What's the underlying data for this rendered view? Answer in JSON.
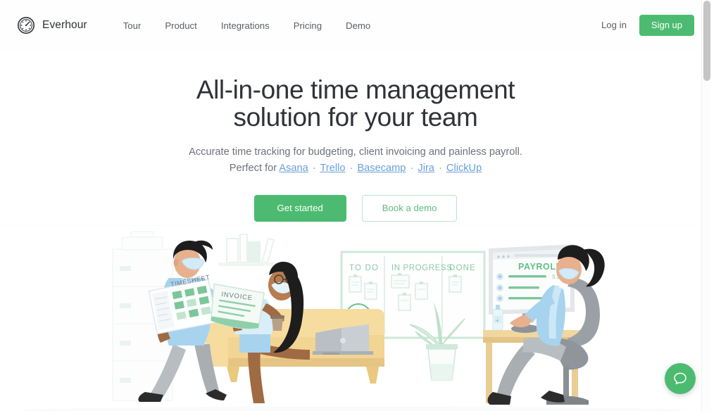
{
  "brand": {
    "name": "Everhour",
    "logo_icon": "clock-timer-icon",
    "accent": "#4cbb71"
  },
  "nav": {
    "items": [
      {
        "label": "Tour"
      },
      {
        "label": "Product"
      },
      {
        "label": "Integrations"
      },
      {
        "label": "Pricing"
      },
      {
        "label": "Demo"
      }
    ]
  },
  "header_right": {
    "login_label": "Log in",
    "signup_label": "Sign up"
  },
  "hero": {
    "title_line1": "All-in-one time management",
    "title_line2": "solution for your team",
    "subtitle": "Accurate time tracking for budgeting, client invoicing and painless payroll.",
    "perfect_for_prefix": "Perfect for",
    "integrations": [
      "Asana",
      "Trello",
      "Basecamp",
      "Jira",
      "ClickUp"
    ],
    "separator": "·",
    "link_color": "#6aa0da",
    "primary_cta": "Get started",
    "secondary_cta": "Book a demo"
  },
  "illustration": {
    "alt": "remote team illustration: masked man handing invoice to seated woman on sofa, kanban board, woman at payroll monitor",
    "kanban": {
      "columns": [
        "TO DO",
        "IN PROGRESS",
        "DONE"
      ]
    },
    "labels": {
      "timesheet": "TIMESHEET",
      "invoice": "INVOICE",
      "payroll": "PAYROLL"
    },
    "play_button_icon": "play-icon",
    "colors": {
      "green_pale": "#d9ece0",
      "green_mid": "#a8d8bd",
      "green_text": "#6fbf8e",
      "sofa": "#f7dca0",
      "sofa_dark": "#e9c77f",
      "skin_light": "#e8b08c",
      "skin_dark": "#a06a43",
      "shirt_blue": "#a8d3ee",
      "gray_pants": "#b6bbbf",
      "dark": "#2b2b2b",
      "chair_gray": "#9aa0a6",
      "mask": "#cfe8f5"
    }
  },
  "chat": {
    "icon": "chat-bubble-icon",
    "color": "#4cbb71"
  },
  "scrollbar": {
    "thumb_color": "#c5c5c5",
    "thumb_top": 1,
    "thumb_height": 114
  }
}
